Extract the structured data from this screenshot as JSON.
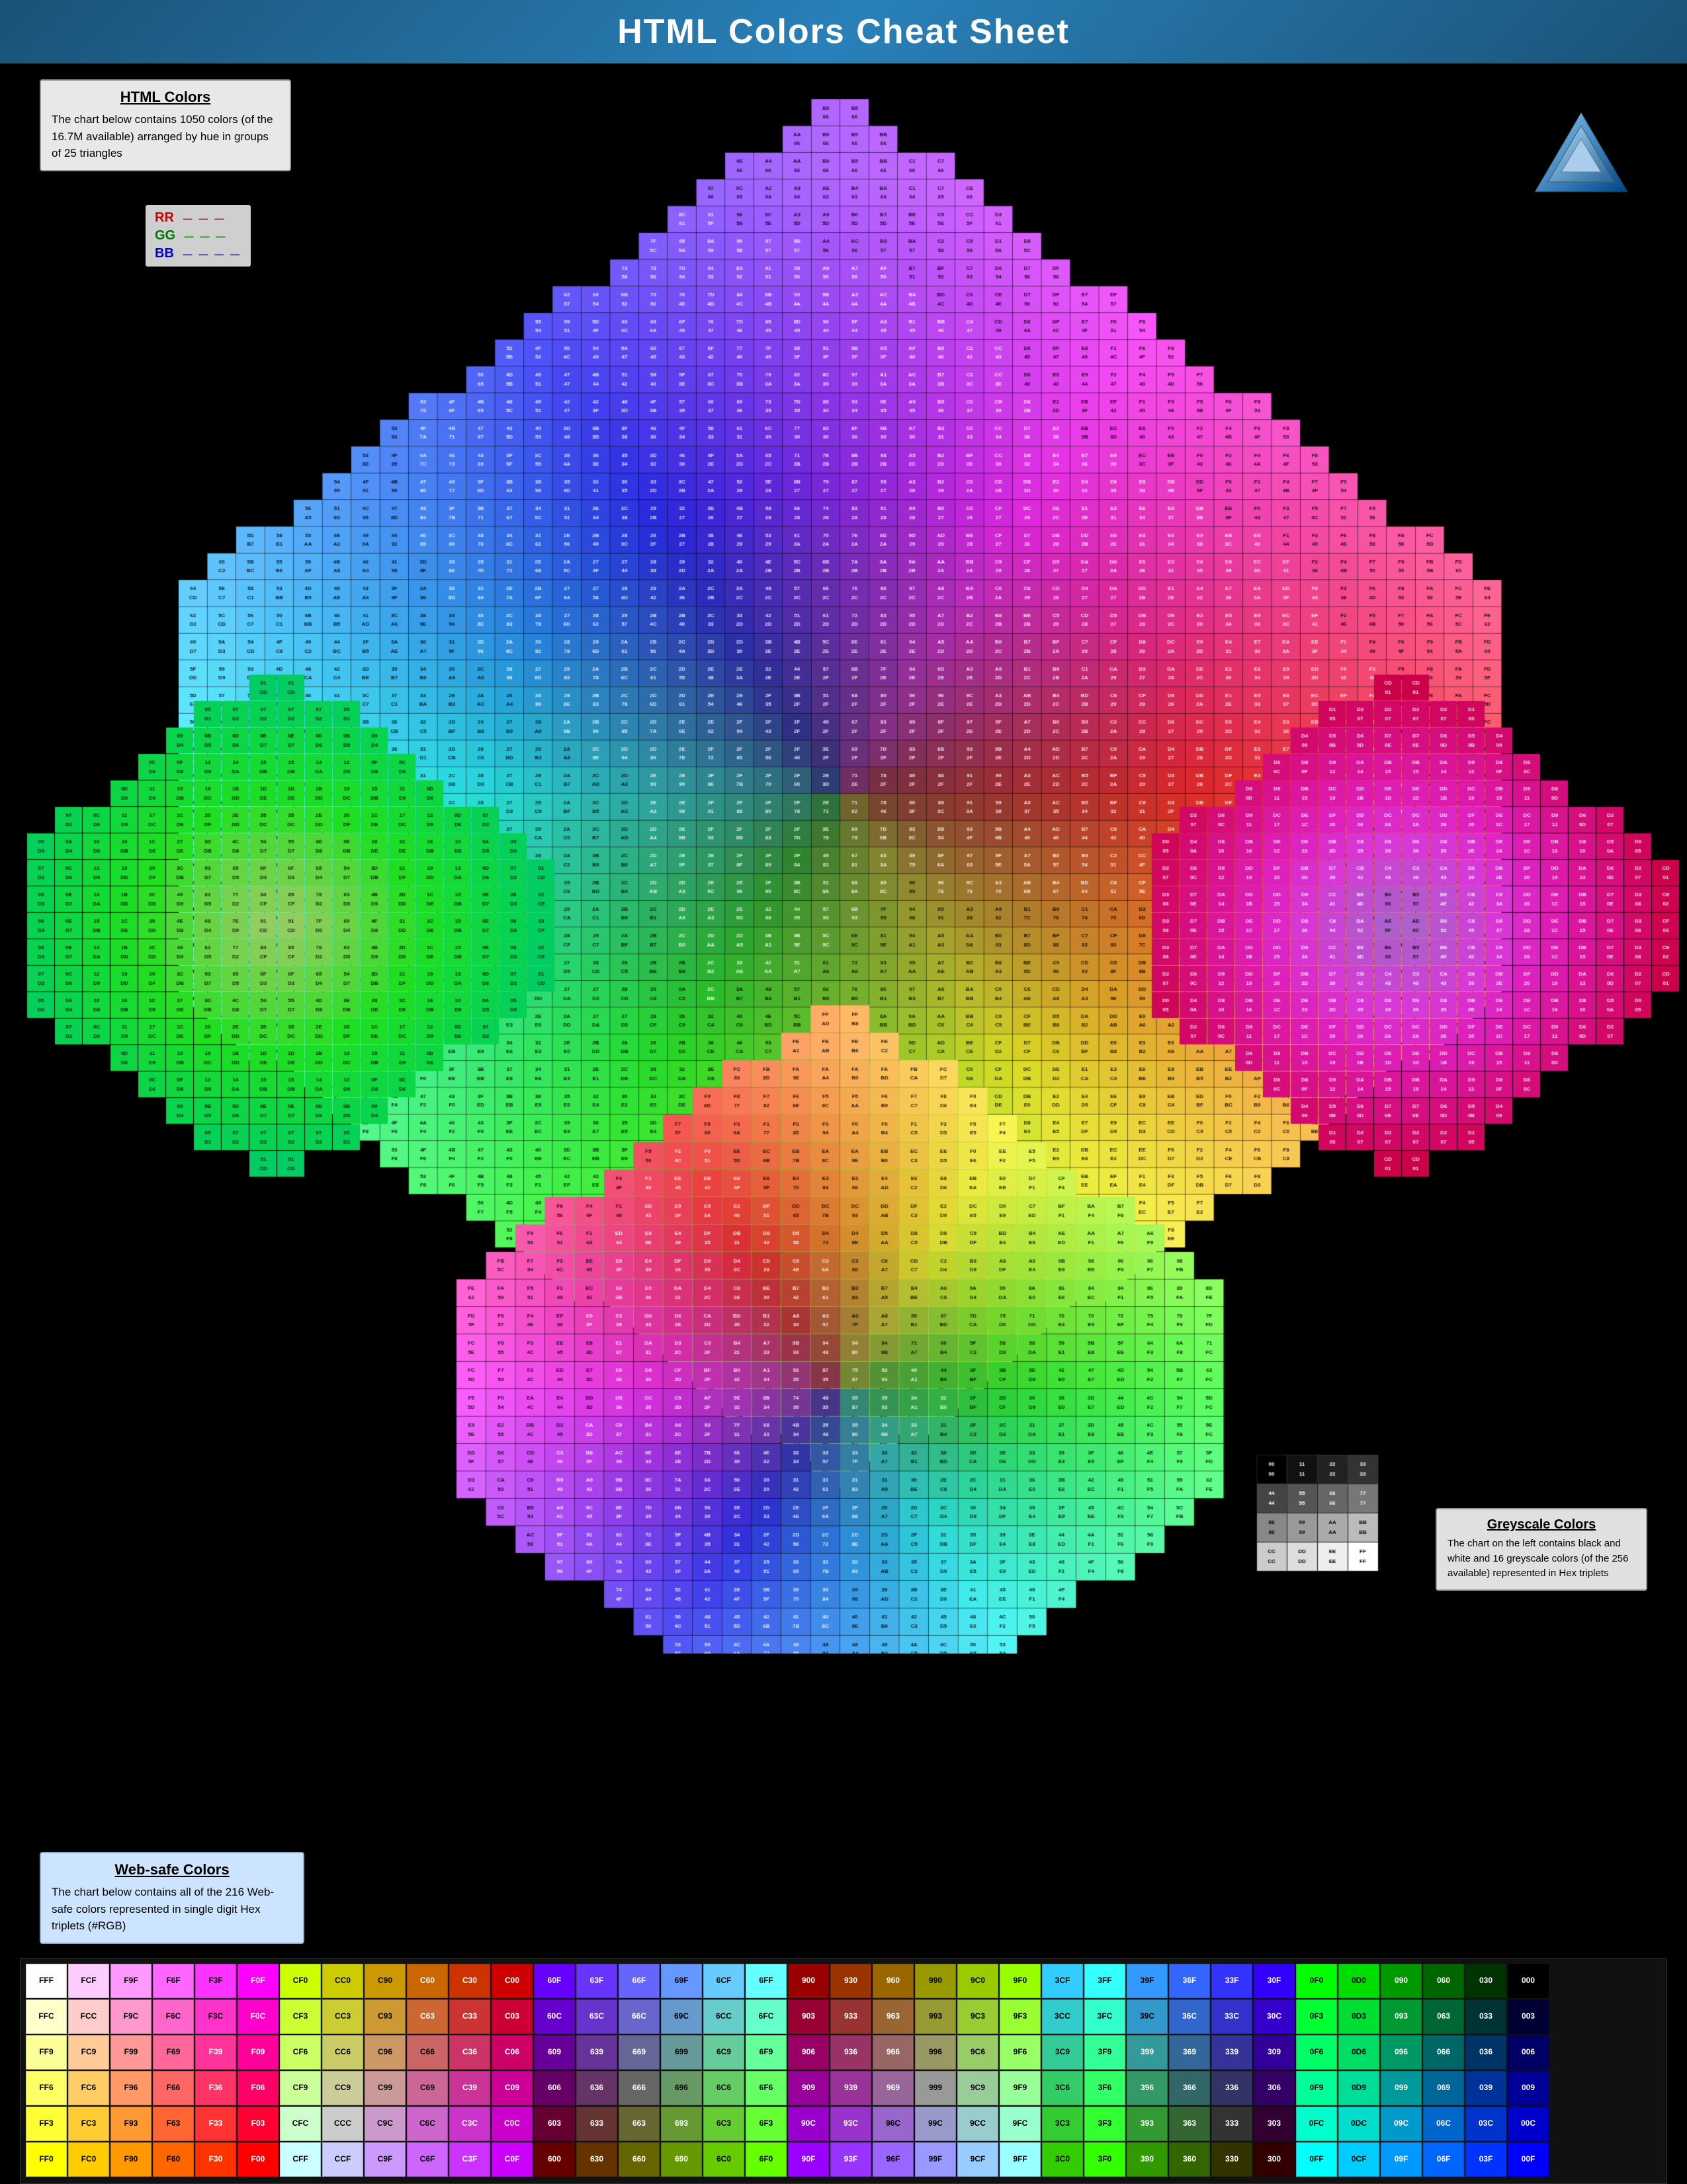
{
  "page": {
    "title": "HTML Colors Cheat Sheet",
    "background": "#000000"
  },
  "html_colors_box": {
    "heading": "HTML Colors",
    "description": "The chart below contains 1050 colors (of the 16.7M available) arranged by hue in groups of 25 triangles"
  },
  "legend": {
    "rr_label": "RR",
    "gg_label": "GG",
    "bb_label": "BB",
    "rr_dashes": "——",
    "gg_dashes": "——",
    "bb_dashes": "———"
  },
  "websafe_box": {
    "heading": "Web-safe Colors",
    "description": "The chart below contains all of the 216 Web-safe colors represented in single digit Hex triplets (#RGB)"
  },
  "greyscale_box": {
    "heading": "Greyscale Colors",
    "description": "The chart on the left contains black and white and 16 greyscale colors (of the 256 available) represented in Hex triplets"
  },
  "websafe_rows": [
    [
      "FFF",
      "FCF",
      "F9F",
      "F6F",
      "F3F",
      "F0F",
      "CF0",
      "CC0",
      "C90",
      "C60",
      "C30",
      "C00",
      "60F",
      "63F",
      "66F",
      "69F",
      "6CF",
      "6FF",
      "900",
      "930",
      "960",
      "990",
      "9C0",
      "9F0",
      "3CF",
      "3FF",
      "39F",
      "36F",
      "33F",
      "30F",
      "0F0",
      "0D0",
      "090",
      "060",
      "030",
      "000"
    ],
    [
      "FFC",
      "FCC",
      "F9C",
      "F6C",
      "F3C",
      "F0C",
      "CF3",
      "CC3",
      "C93",
      "C63",
      "C33",
      "C03",
      "60C",
      "63C",
      "66C",
      "69C",
      "6CC",
      "6FC",
      "903",
      "933",
      "963",
      "993",
      "9C3",
      "9F3",
      "3CC",
      "3FC",
      "39C",
      "36C",
      "33C",
      "30C",
      "0F3",
      "0D3",
      "093",
      "063",
      "033",
      "003"
    ],
    [
      "FF9",
      "FC9",
      "F99",
      "F69",
      "F39",
      "F09",
      "CF6",
      "CC6",
      "C96",
      "C66",
      "C36",
      "C06",
      "609",
      "639",
      "669",
      "699",
      "6C9",
      "6F9",
      "906",
      "936",
      "966",
      "996",
      "9C6",
      "9F6",
      "3C9",
      "3F9",
      "399",
      "369",
      "339",
      "309",
      "0F6",
      "0D6",
      "096",
      "066",
      "036",
      "006"
    ],
    [
      "FF6",
      "FC6",
      "F96",
      "F66",
      "F36",
      "F06",
      "CF9",
      "CC9",
      "C99",
      "C69",
      "C39",
      "C09",
      "606",
      "636",
      "666",
      "696",
      "6C6",
      "6F6",
      "909",
      "939",
      "969",
      "999",
      "9C9",
      "9F9",
      "3C6",
      "3F6",
      "396",
      "366",
      "336",
      "306",
      "0F9",
      "0D9",
      "099",
      "069",
      "039",
      "009"
    ],
    [
      "FF3",
      "FC3",
      "F93",
      "F63",
      "F33",
      "F03",
      "CFC",
      "CCC",
      "C9C",
      "C6C",
      "C3C",
      "C0C",
      "603",
      "633",
      "663",
      "693",
      "6C3",
      "6F3",
      "90C",
      "93C",
      "96C",
      "99C",
      "9CC",
      "9FC",
      "3C3",
      "3F3",
      "393",
      "363",
      "333",
      "303",
      "0FC",
      "0DC",
      "09C",
      "06C",
      "03C",
      "00C"
    ],
    [
      "FF0",
      "FC0",
      "F90",
      "F60",
      "F30",
      "F00",
      "CFF",
      "CCF",
      "C9F",
      "C6F",
      "C3F",
      "C0F",
      "600",
      "630",
      "660",
      "690",
      "6C0",
      "6F0",
      "90F",
      "93F",
      "96F",
      "99F",
      "9CF",
      "9FF",
      "3C0",
      "3F0",
      "390",
      "360",
      "330",
      "300",
      "0FF",
      "0CF",
      "09F",
      "06F",
      "03F",
      "00F"
    ]
  ]
}
